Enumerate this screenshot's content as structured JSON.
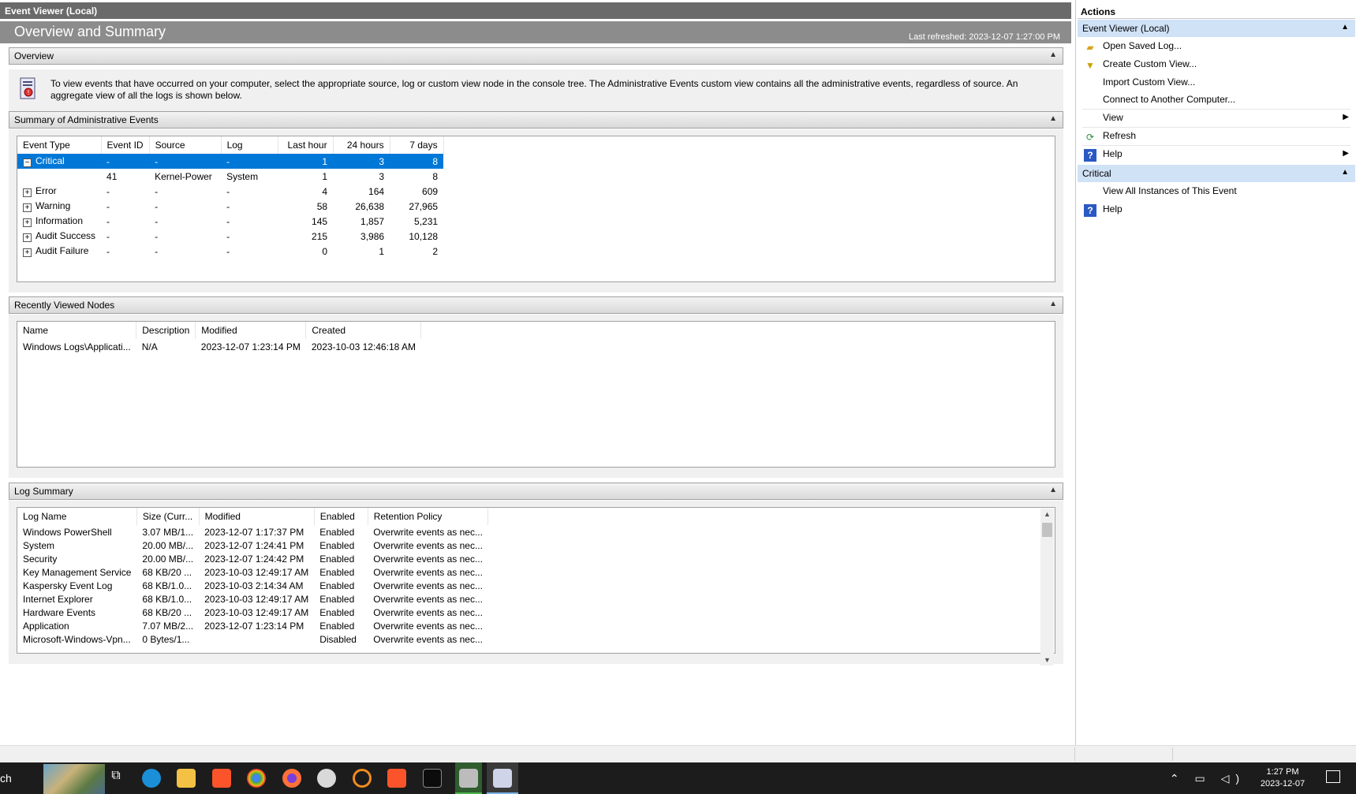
{
  "window": {
    "left_title": "Event Viewer (Local)",
    "header_title": "Overview and Summary",
    "last_refreshed": "Last refreshed: 2023-12-07 1:27:00 PM"
  },
  "overview": {
    "section_label": "Overview",
    "text": "To view events that have occurred on your computer, select the appropriate source, log or custom view node in the console tree. The Administrative Events custom view contains all the administrative events, regardless of source. An aggregate view of all the logs is shown below."
  },
  "summary": {
    "section_label": "Summary of Administrative Events",
    "columns": [
      "Event Type",
      "Event ID",
      "Source",
      "Log",
      "Last hour",
      "24 hours",
      "7 days"
    ],
    "rows": [
      {
        "expander": "−",
        "type": "Critical",
        "id": "-",
        "source": "-",
        "log": "-",
        "hour": "1",
        "day": "3",
        "week": "8",
        "selected": true
      },
      {
        "expander": "",
        "type": "",
        "id": "41",
        "source": "Kernel-Power",
        "log": "System",
        "hour": "1",
        "day": "3",
        "week": "8"
      },
      {
        "expander": "+",
        "type": "Error",
        "id": "-",
        "source": "-",
        "log": "-",
        "hour": "4",
        "day": "164",
        "week": "609"
      },
      {
        "expander": "+",
        "type": "Warning",
        "id": "-",
        "source": "-",
        "log": "-",
        "hour": "58",
        "day": "26,638",
        "week": "27,965"
      },
      {
        "expander": "+",
        "type": "Information",
        "id": "-",
        "source": "-",
        "log": "-",
        "hour": "145",
        "day": "1,857",
        "week": "5,231"
      },
      {
        "expander": "+",
        "type": "Audit Success",
        "id": "-",
        "source": "-",
        "log": "-",
        "hour": "215",
        "day": "3,986",
        "week": "10,128"
      },
      {
        "expander": "+",
        "type": "Audit Failure",
        "id": "-",
        "source": "-",
        "log": "-",
        "hour": "0",
        "day": "1",
        "week": "2"
      }
    ]
  },
  "recent": {
    "section_label": "Recently Viewed Nodes",
    "columns": [
      "Name",
      "Description",
      "Modified",
      "Created"
    ],
    "rows": [
      {
        "name": "Windows Logs\\Applicati...",
        "description": "N/A",
        "modified": "2023-12-07 1:23:14 PM",
        "created": "2023-10-03 12:46:18 AM"
      }
    ]
  },
  "log_summary": {
    "section_label": "Log Summary",
    "columns": [
      "Log Name",
      "Size (Curr...",
      "Modified",
      "Enabled",
      "Retention Policy"
    ],
    "rows": [
      {
        "name": "Windows PowerShell",
        "size": "3.07 MB/1...",
        "modified": "2023-12-07 1:17:37 PM",
        "enabled": "Enabled",
        "retention": "Overwrite events as nec..."
      },
      {
        "name": "System",
        "size": "20.00 MB/...",
        "modified": "2023-12-07 1:24:41 PM",
        "enabled": "Enabled",
        "retention": "Overwrite events as nec..."
      },
      {
        "name": "Security",
        "size": "20.00 MB/...",
        "modified": "2023-12-07 1:24:42 PM",
        "enabled": "Enabled",
        "retention": "Overwrite events as nec..."
      },
      {
        "name": "Key Management Service",
        "size": "68 KB/20 ...",
        "modified": "2023-10-03 12:49:17 AM",
        "enabled": "Enabled",
        "retention": "Overwrite events as nec..."
      },
      {
        "name": "Kaspersky Event Log",
        "size": "68 KB/1.0...",
        "modified": "2023-10-03 2:14:34 AM",
        "enabled": "Enabled",
        "retention": "Overwrite events as nec..."
      },
      {
        "name": "Internet Explorer",
        "size": "68 KB/1.0...",
        "modified": "2023-10-03 12:49:17 AM",
        "enabled": "Enabled",
        "retention": "Overwrite events as nec..."
      },
      {
        "name": "Hardware Events",
        "size": "68 KB/20 ...",
        "modified": "2023-10-03 12:49:17 AM",
        "enabled": "Enabled",
        "retention": "Overwrite events as nec..."
      },
      {
        "name": "Application",
        "size": "7.07 MB/2...",
        "modified": "2023-12-07 1:23:14 PM",
        "enabled": "Enabled",
        "retention": "Overwrite events as nec..."
      },
      {
        "name": "Microsoft-Windows-Vpn...",
        "size": "0 Bytes/1...",
        "modified": "",
        "enabled": "Disabled",
        "retention": "Overwrite events as nec..."
      }
    ]
  },
  "actions": {
    "title": "Actions",
    "group1": {
      "label": "Event Viewer (Local)",
      "items": [
        {
          "label": "Open Saved Log...",
          "icon": "folder-open-icon",
          "arrow": false
        },
        {
          "label": "Create Custom View...",
          "icon": "filter-icon",
          "arrow": false
        },
        {
          "label": "Import Custom View...",
          "icon": "",
          "arrow": false
        },
        {
          "label": "Connect to Another Computer...",
          "icon": "",
          "arrow": false
        },
        {
          "label": "View",
          "icon": "",
          "arrow": true
        },
        {
          "label": "Refresh",
          "icon": "refresh-icon",
          "arrow": false
        },
        {
          "label": "Help",
          "icon": "help-icon",
          "arrow": true
        }
      ]
    },
    "group2": {
      "label": "Critical",
      "items": [
        {
          "label": "View All Instances of This Event",
          "icon": "",
          "arrow": false
        },
        {
          "label": "Help",
          "icon": "help-icon",
          "arrow": false
        }
      ]
    }
  },
  "taskbar": {
    "search_text": "ch",
    "time": "1:27 PM",
    "date": "2023-12-07"
  },
  "colors": {
    "selection": "#0078d7",
    "group_header": "#d0e2f6",
    "header_band": "#8c8c8c"
  }
}
